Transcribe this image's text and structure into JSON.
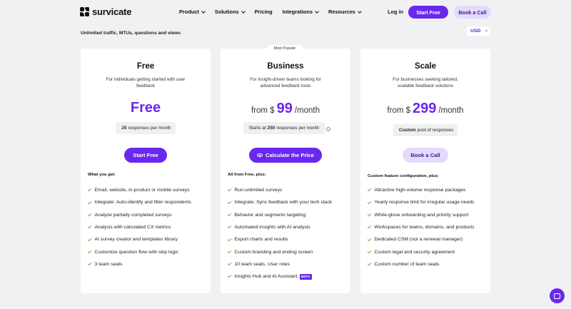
{
  "nav": {
    "logo": "survicate",
    "menu": [
      {
        "label": "Product",
        "has_dropdown": true
      },
      {
        "label": "Solutions",
        "has_dropdown": true
      },
      {
        "label": "Pricing",
        "has_dropdown": false
      },
      {
        "label": "Integrations",
        "has_dropdown": true
      },
      {
        "label": "Resources",
        "has_dropdown": true
      }
    ],
    "login": "Log in",
    "start_free": "Start Free",
    "book_call": "Book a Call"
  },
  "subheading": "Unlimited traffic, MTUs, questions and views",
  "currency": {
    "selected": "USD"
  },
  "plans": [
    {
      "title": "Free",
      "description": "For individuals getting started with user feedback",
      "price_label": "Free",
      "pill": {
        "bold": "25",
        "text": "responses per month"
      },
      "cta": "Start Free",
      "features_heading": "What you get:",
      "features": [
        "Email, website, in-product or mobile surveys",
        "Integrate: Auto-identify and filter respondents",
        "Analyze partially completed surveys",
        "Analysis with calculated CX metrics",
        "AI survey creator and templates library",
        "Customize question flow with skip logic",
        "3 team seats"
      ]
    },
    {
      "title": "Business",
      "badge": "Most Popular",
      "description": "For insight-driven teams looking for advanced feedback tools",
      "price": {
        "from": "from $",
        "amount": "99",
        "per": "/month"
      },
      "pill": {
        "prefix": "Starts at",
        "bold": "250",
        "text": "responses per month"
      },
      "cta": "Calculate the Price",
      "features_heading": "All from Free, plus:",
      "features": [
        "Run unlimited surveys",
        "Integrate: Sync feedback with your tech stack",
        "Behavior and segments targeting",
        "Automated insights with AI analysis",
        "Export charts and results",
        "Custom branding and ending screen",
        "10 team seats, User roles",
        "Insights Hub and AI Assistant"
      ],
      "beta_label": "BETA"
    },
    {
      "title": "Scale",
      "description": "For businesses seeking tailored, scalable feedback solutions",
      "price": {
        "from": "from $",
        "amount": "299",
        "per": "/month"
      },
      "pill": {
        "bold": "Custom",
        "text": "pool of responses"
      },
      "cta": "Book a Call",
      "features_heading": "Custom feature configuration, plus:",
      "features": [
        "Attractive high-volume response packages",
        "Yearly response limit for irregular usage needs",
        "White-glove onboarding and priority support",
        "Workspaces for teams, domains, and products",
        "Dedicated CSM (not a renewal manager)",
        "Custom legal and security agreement",
        "Custom number of team seats"
      ]
    }
  ],
  "colors": {
    "accent": "#6a27f0",
    "accent_light": "#e4dafc",
    "check": "#6ab24a",
    "background": "#f1f1f3"
  },
  "icons": [
    "survicate-logo-icon",
    "chevron-down-icon",
    "eye-icon",
    "info-icon",
    "check-icon",
    "chat-icon"
  ]
}
